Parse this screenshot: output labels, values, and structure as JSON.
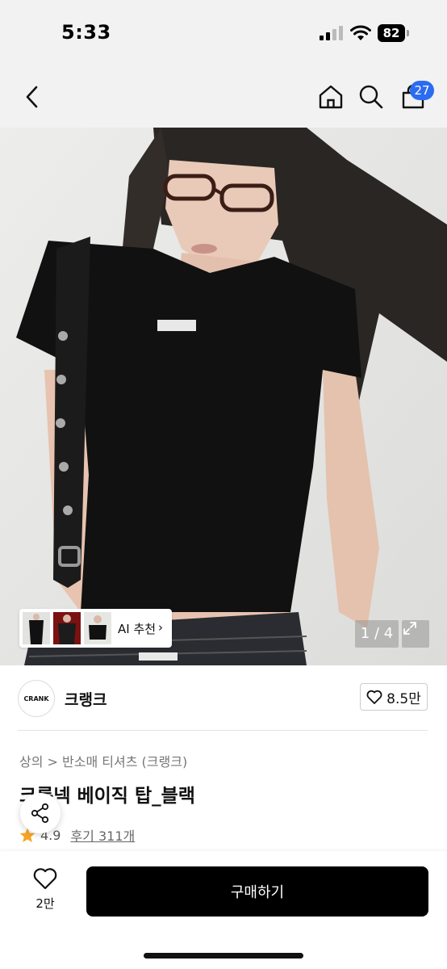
{
  "status_bar": {
    "time": "5:33",
    "battery": "82"
  },
  "nav": {
    "cart_count": "27",
    "icons": [
      "back-icon",
      "home-icon",
      "search-icon",
      "cart-icon"
    ]
  },
  "gallery": {
    "ai_label": "AI 추천",
    "counter": "1 / 4"
  },
  "brand": {
    "logo_text": "CRANK",
    "name": "크랭크",
    "likes": "8.5만"
  },
  "breadcrumb": {
    "category": "상의",
    "separator": ">",
    "sub": "반소매 티셔츠 (크랭크)"
  },
  "product": {
    "title": "크롭넥 베이직 탑_블랙",
    "rating": "4.9",
    "reviews": "후기 311개"
  },
  "bottom": {
    "wish_count": "2만",
    "buy_label": "구매하기"
  },
  "colors": {
    "accent": "#2b6cf0",
    "star": "#f5a623",
    "buy": "#000000"
  }
}
